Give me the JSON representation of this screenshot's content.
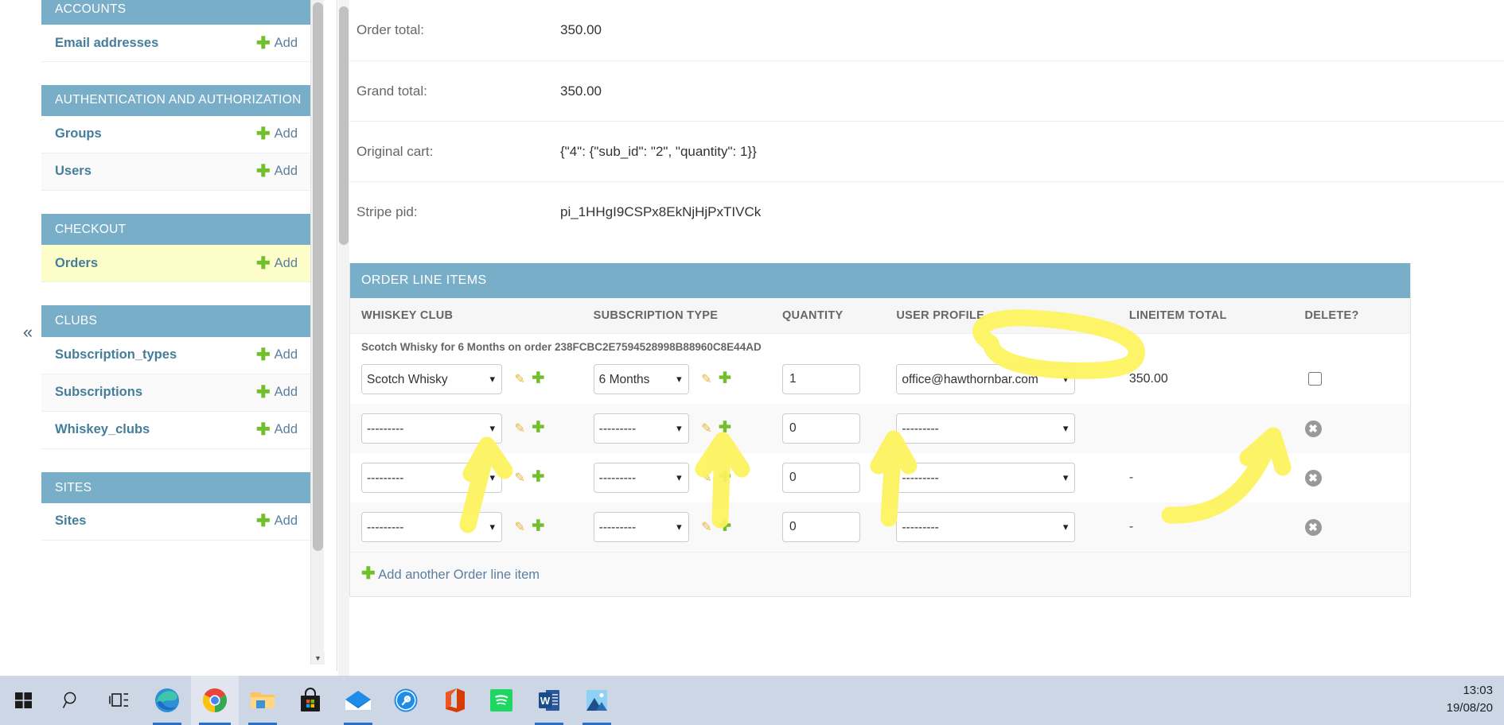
{
  "sidebar": {
    "collapse_icon": "«",
    "groups": [
      {
        "header": "ACCOUNTS",
        "items": [
          {
            "label": "Email addresses",
            "add_label": "Add",
            "current": false
          }
        ]
      },
      {
        "header": "AUTHENTICATION AND AUTHORIZATION",
        "items": [
          {
            "label": "Groups",
            "add_label": "Add",
            "current": false
          },
          {
            "label": "Users",
            "add_label": "Add",
            "current": false
          }
        ]
      },
      {
        "header": "CHECKOUT",
        "items": [
          {
            "label": "Orders",
            "add_label": "Add",
            "current": true
          }
        ]
      },
      {
        "header": "CLUBS",
        "items": [
          {
            "label": "Subscription_types",
            "add_label": "Add",
            "current": false
          },
          {
            "label": "Subscriptions",
            "add_label": "Add",
            "current": false
          },
          {
            "label": "Whiskey_clubs",
            "add_label": "Add",
            "current": false
          }
        ]
      },
      {
        "header": "SITES",
        "items": [
          {
            "label": "Sites",
            "add_label": "Add",
            "current": false
          }
        ]
      }
    ]
  },
  "main": {
    "fields": [
      {
        "label": "Order total:",
        "value": "350.00"
      },
      {
        "label": "Grand total:",
        "value": "350.00"
      },
      {
        "label": "Original cart:",
        "value": "{\"4\": {\"sub_id\": \"2\", \"quantity\": 1}}"
      },
      {
        "label": "Stripe pid:",
        "value": "pi_1HHgI9CSPx8EkNjHjPxTIVCk"
      }
    ],
    "inline": {
      "title": "ORDER LINE ITEMS",
      "columns": [
        "WHISKEY CLUB",
        "SUBSCRIPTION TYPE",
        "QUANTITY",
        "USER PROFILE",
        "LINEITEM TOTAL",
        "DELETE?"
      ],
      "row_caption": "Scotch Whisky for 6 Months on order 238FCBC2E7594528998B88960C8E44AD",
      "empty_option": "---------",
      "rows": [
        {
          "whiskey_club": "Scotch Whisky",
          "subscription_type": "6 Months",
          "quantity": "1",
          "user_profile": "office@hawthornbar.com",
          "lineitem_total": "350.00",
          "delete_control": "checkbox",
          "has_caption": true
        },
        {
          "whiskey_club": "---------",
          "subscription_type": "---------",
          "quantity": "0",
          "user_profile": "---------",
          "lineitem_total": "",
          "delete_control": "remove-icon",
          "has_caption": false
        },
        {
          "whiskey_club": "---------",
          "subscription_type": "---------",
          "quantity": "0",
          "user_profile": "---------",
          "lineitem_total": "-",
          "delete_control": "remove-icon",
          "has_caption": false
        },
        {
          "whiskey_club": "---------",
          "subscription_type": "---------",
          "quantity": "0",
          "user_profile": "---------",
          "lineitem_total": "-",
          "delete_control": "remove-icon",
          "has_caption": false
        }
      ],
      "add_another_label": "Add another Order line item"
    }
  },
  "annotations": {
    "color": "#fdf35c",
    "marks": [
      {
        "kind": "circle",
        "target": "USER PROFILE header"
      },
      {
        "kind": "arrow",
        "target": "whiskey club select row 2"
      },
      {
        "kind": "arrow",
        "target": "subscription type select row 2"
      },
      {
        "kind": "arrow",
        "target": "quantity input row 2"
      },
      {
        "kind": "arrow",
        "target": "lineitem total row 2"
      }
    ]
  },
  "taskbar": {
    "icons": [
      "windows-start-icon",
      "search-icon",
      "task-view-icon",
      "edge-icon",
      "chrome-icon",
      "file-explorer-icon",
      "microsoft-store-icon",
      "mail-icon",
      "tool-icon",
      "office-icon",
      "spotify-icon",
      "word-icon",
      "photos-icon"
    ],
    "clock_time": "13:03",
    "clock_date": "19/08/20"
  },
  "theme": {
    "header_blue": "#79aec8",
    "link_blue": "#447e9b",
    "green": "#70bf2b",
    "highlight_yellow": "#fdfdc9",
    "taskbar_bg": "#cdd6e5"
  }
}
